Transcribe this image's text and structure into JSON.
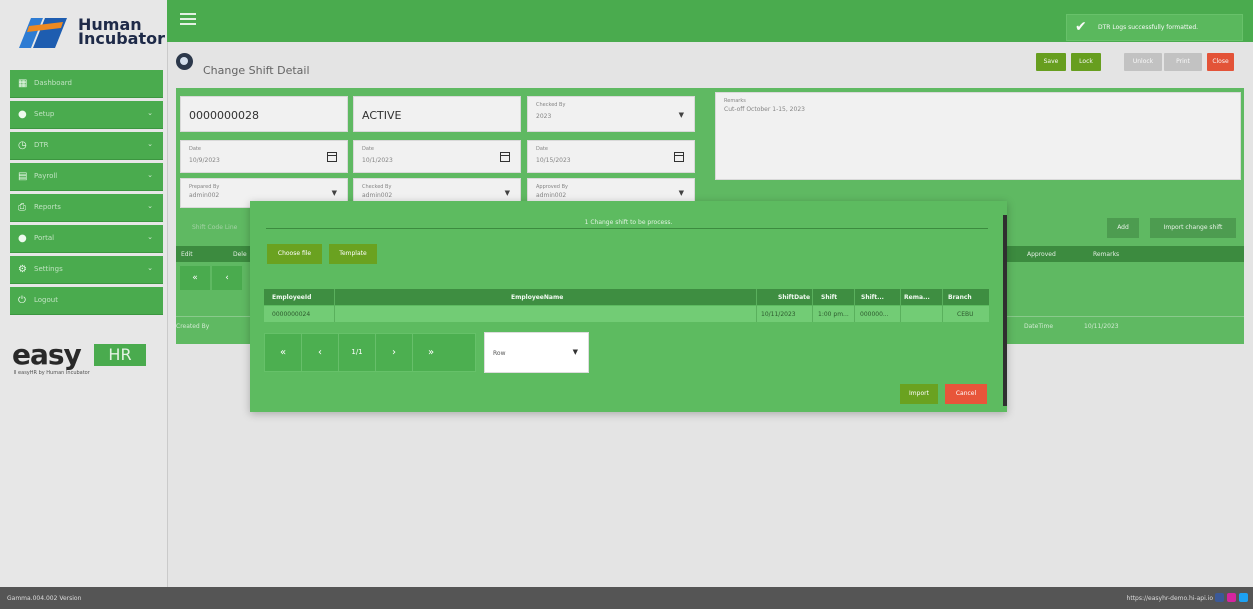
{
  "brand": {
    "logo_line1": "Human",
    "logo_line2": "Incubator",
    "easy_text": "easy",
    "hr_text": "HR",
    "easy_sub": "Ⅱ easyHR by Human Incubator"
  },
  "sidebar": {
    "items": [
      {
        "label": "Dashboard",
        "icon": "dashboard-icon",
        "glyph": "▦",
        "chevron": false
      },
      {
        "label": "Setup",
        "icon": "setup-icon",
        "glyph": "●",
        "chevron": true
      },
      {
        "label": "DTR",
        "icon": "clock-icon",
        "glyph": "◷",
        "chevron": true
      },
      {
        "label": "Payroll",
        "icon": "payroll-icon",
        "glyph": "▤",
        "chevron": true
      },
      {
        "label": "Reports",
        "icon": "print-icon",
        "glyph": "⎙",
        "chevron": true
      },
      {
        "label": "Portal",
        "icon": "portal-icon",
        "glyph": "●",
        "chevron": true
      },
      {
        "label": "Settings",
        "icon": "settings-icon",
        "glyph": "⚙",
        "chevron": true
      },
      {
        "label": "Logout",
        "icon": "power-icon",
        "glyph": "⏻",
        "chevron": false
      }
    ]
  },
  "toast": {
    "message": "DTR Logs successfully formatted."
  },
  "page": {
    "title": "Change Shift Detail",
    "buttons": [
      {
        "label": "Save",
        "color": "#6aa220"
      },
      {
        "label": "Lock",
        "color": "#6aa220"
      },
      {
        "label": "Unlock",
        "color": "#c6c6c6"
      },
      {
        "label": "Print",
        "color": "#c6c6c6"
      },
      {
        "label": "Close",
        "color": "#e8553a"
      }
    ]
  },
  "form": {
    "number": "0000000028",
    "status": "ACTIVE",
    "checked_by_top_label": "Checked By",
    "checked_by_top_value": "2023",
    "remarks_label": "Remarks",
    "remarks_value": "Cut-off October 1-15, 2023",
    "date1_label": "Date",
    "date1_value": "10/9/2023",
    "date2_label": "Date",
    "date2_value": "10/1/2023",
    "date3_label": "Date",
    "date3_value": "10/15/2023",
    "prepared_label": "Prepared By",
    "prepared_value": "admin002",
    "checked_label": "Checked By",
    "checked_value": "admin002",
    "approved_label": "Approved By",
    "approved_value": "admin002",
    "shift_code_label": "Shift Code Line",
    "add_label": "Add",
    "import_label": "Import change shift",
    "grid_cols": [
      "Edit",
      "Dele",
      "Approved",
      "Remarks"
    ],
    "pager_first": "«",
    "pager_prev": "‹",
    "created_by_label": "Created By",
    "datetime_label": "DateTime",
    "datetime_value": "10/11/2023"
  },
  "modal": {
    "title": "1 Change shift to be process.",
    "choose_file": "Choose file",
    "template": "Template",
    "columns": [
      "EmployeeId",
      "EmployeeName",
      "ShiftDate",
      "Shift",
      "Shift...",
      "Rema...",
      "Branch"
    ],
    "rows": [
      [
        "0000000024",
        "",
        "10/11/2023",
        "1:00 pm...",
        "000000...",
        "",
        "CEBU"
      ]
    ],
    "pager": {
      "first": "«",
      "prev": "‹",
      "page": "1/1",
      "next": "›",
      "last": "»"
    },
    "row_select": "Row",
    "import": "Import",
    "cancel": "Cancel"
  },
  "footer": {
    "version": "Gamma.004.002 Version",
    "url": "https://easyhr-demo.hi-api.io"
  },
  "colors": {
    "green": "#4caf50",
    "panel_green": "#61bd64",
    "close_red": "#e8553a"
  }
}
